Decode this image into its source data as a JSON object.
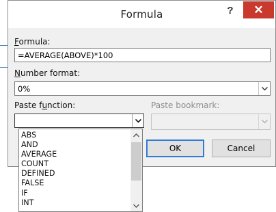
{
  "dialog": {
    "title": "Formula",
    "help_label": "?",
    "close_label": "✕"
  },
  "formula": {
    "label_accel": "F",
    "label_rest": "ormula:",
    "value": "=AVERAGE(ABOVE)*100"
  },
  "number_format": {
    "label_accel": "N",
    "label_rest": "umber format:",
    "value": "0%"
  },
  "paste_function": {
    "label_pre": "Paste f",
    "label_accel": "u",
    "label_post": "nction:",
    "value": "",
    "options": [
      "ABS",
      "AND",
      "AVERAGE",
      "COUNT",
      "DEFINED",
      "FALSE",
      "IF",
      "INT"
    ]
  },
  "paste_bookmark": {
    "label": "Paste bookmark:",
    "value": ""
  },
  "buttons": {
    "ok": "OK",
    "cancel": "Cancel"
  },
  "colors": {
    "close_button": "#c9392d",
    "default_button_border": "#2f7bd6",
    "background_lines": "#4a84c2"
  },
  "icons": [
    "help-icon",
    "close-icon",
    "chevron-down-icon",
    "scroll-up-icon",
    "scroll-down-icon"
  ]
}
